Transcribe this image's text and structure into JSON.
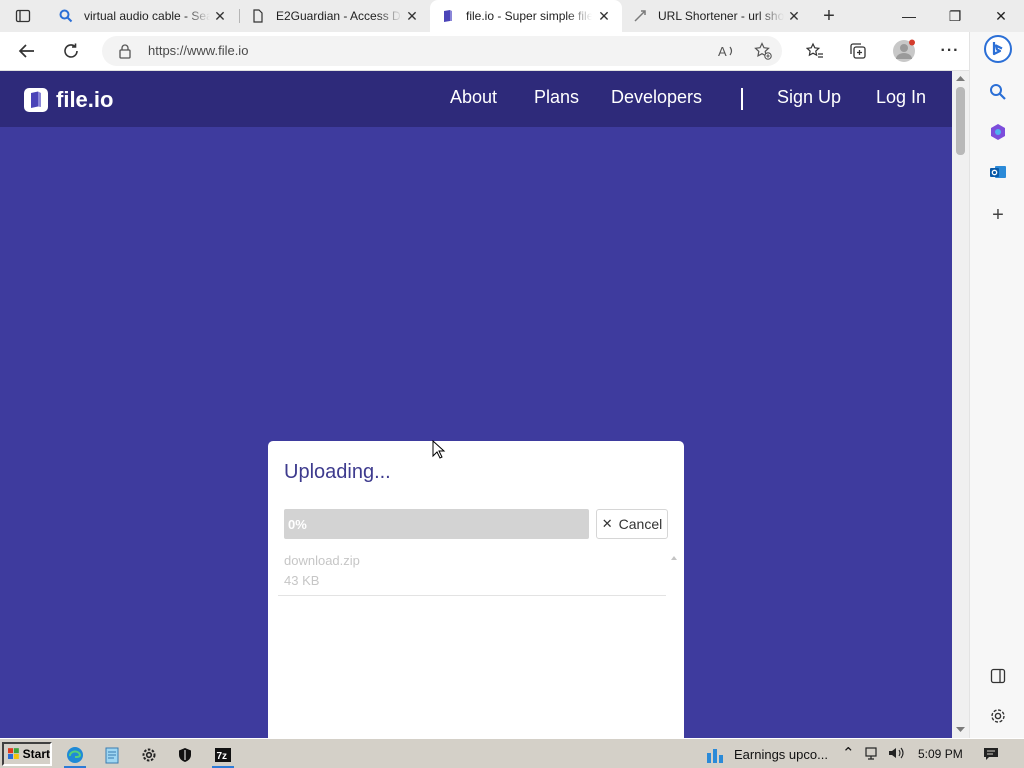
{
  "browser": {
    "tabs": [
      {
        "label": "virtual audio cable - Sea",
        "icon": "search-icon",
        "active": false
      },
      {
        "label": "E2Guardian - Access De",
        "icon": "page-icon",
        "active": false
      },
      {
        "label": "file.io - Super simple file",
        "icon": "fileio-icon",
        "active": true
      },
      {
        "label": "URL Shortener - url sho",
        "icon": "link-icon",
        "active": false
      }
    ],
    "address": "https://www.file.io"
  },
  "site": {
    "logo_text": "file.io",
    "nav": {
      "about": "About",
      "plans": "Plans",
      "developers": "Developers",
      "signup": "Sign Up",
      "login": "Log In"
    }
  },
  "upload": {
    "title": "Uploading...",
    "progress_percent": 0,
    "progress_label": "0%",
    "cancel_label": "Cancel",
    "file": {
      "name": "download.zip",
      "size": "43 KB"
    }
  },
  "taskbar": {
    "start_label": "Start",
    "news_text": "Earnings upco...",
    "time": "5:09 PM"
  },
  "colors": {
    "page_bg": "#3e3b9e",
    "header_bg": "#2e2a7a",
    "accent": "#3e3b8e"
  }
}
